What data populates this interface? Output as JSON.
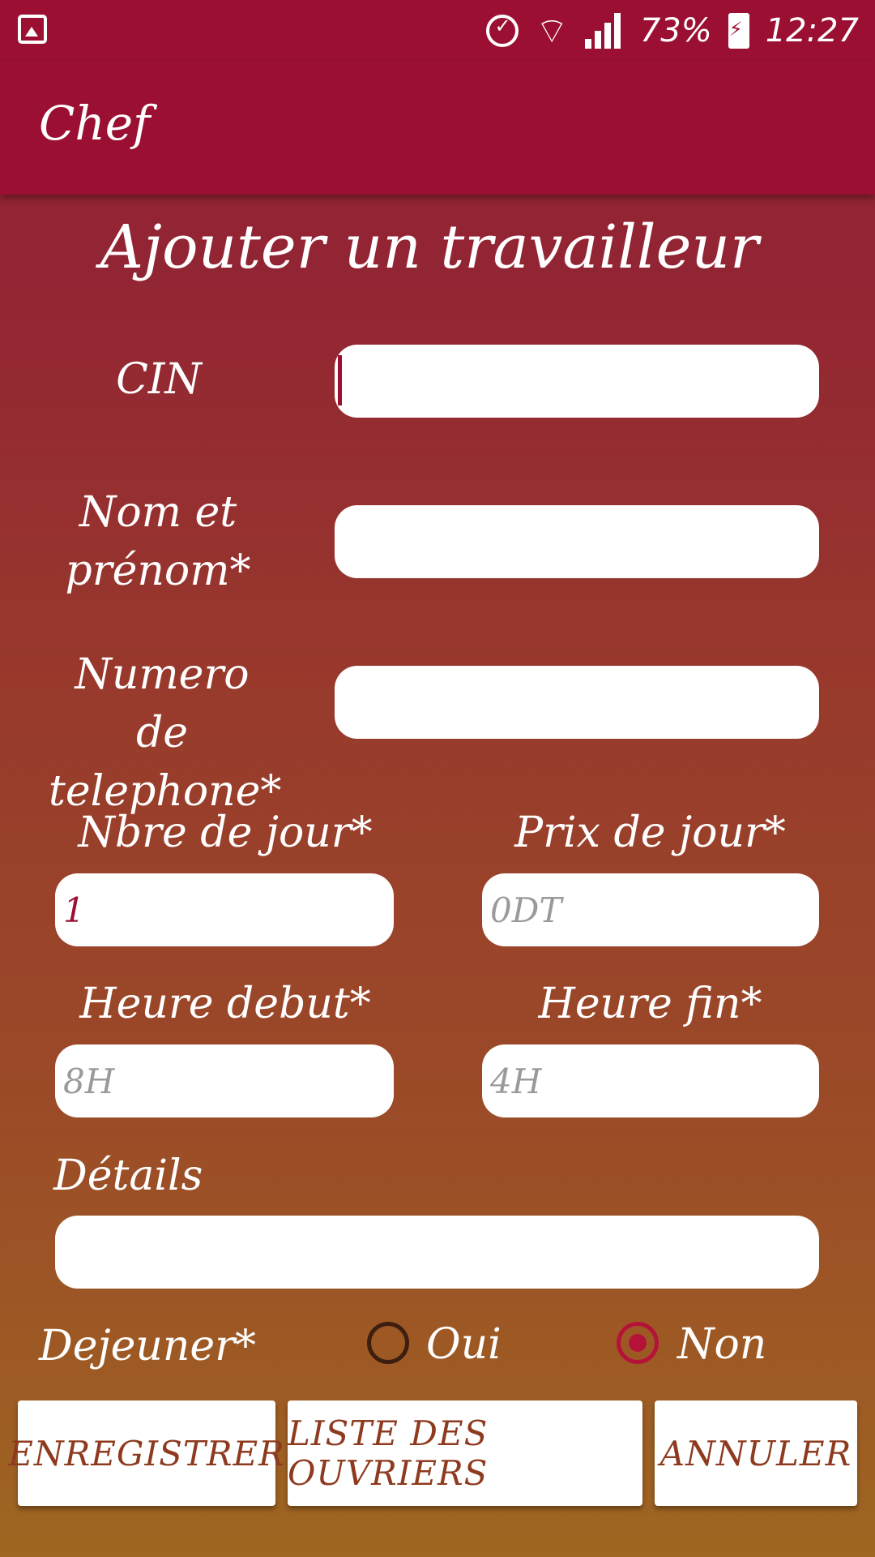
{
  "status_bar": {
    "battery_text": "73%",
    "time": "12:27",
    "icons": [
      "gallery-icon",
      "alarm-icon",
      "wifi-icon",
      "signal-icon",
      "battery-charging-icon"
    ]
  },
  "app_bar": {
    "title": "Chef"
  },
  "form": {
    "title": "Ajouter un travailleur",
    "cin_label": "CIN",
    "cin_value": "",
    "name_label_line1": "Nom et",
    "name_label_line2": "prénom*",
    "name_value": "",
    "phone_label_line1": "Numero de",
    "phone_label_line2": "telephone*",
    "phone_value": "",
    "days_label": "Nbre de jour*",
    "days_value": "1",
    "price_label": "Prix de jour*",
    "price_placeholder": "0DT",
    "start_label": "Heure debut*",
    "start_placeholder": "8H",
    "end_label": "Heure fin*",
    "end_placeholder": "4H",
    "details_label": "Détails",
    "details_value": "",
    "lunch_label": "Dejeuner*",
    "lunch_yes": "Oui",
    "lunch_no": "Non",
    "lunch_selected": "Non"
  },
  "buttons": {
    "save": "ENREGISTRER",
    "workers_list": "LISTE DES OUVRIERS",
    "cancel": "ANNULER"
  },
  "colors": {
    "primary": "#9b1032",
    "accent": "#b5123a",
    "button_text": "#8e3a1f"
  }
}
